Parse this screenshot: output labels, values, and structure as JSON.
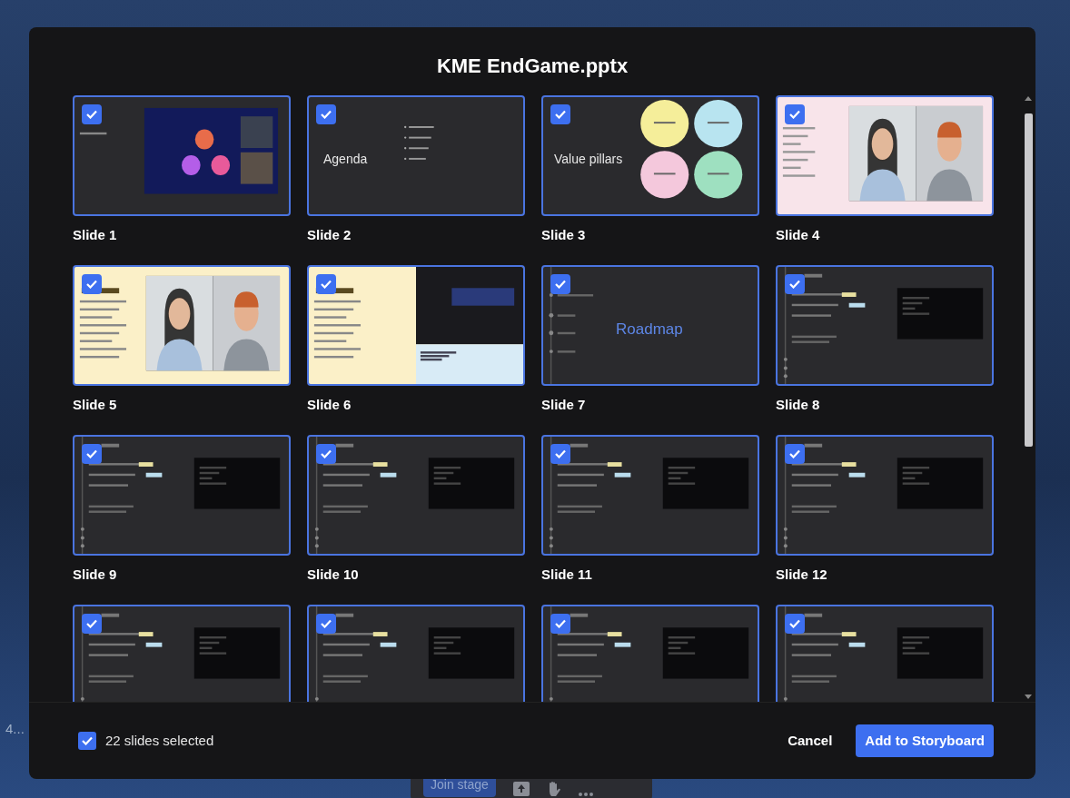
{
  "background": {
    "side_text": "4...",
    "stage_button": "Join stage"
  },
  "dialog": {
    "title": "KME EndGame.pptx"
  },
  "slides": [
    {
      "label": "Slide 1",
      "kind": "intro",
      "selected": true
    },
    {
      "label": "Slide 2",
      "kind": "agenda",
      "heading": "Agenda",
      "selected": true
    },
    {
      "label": "Slide 3",
      "kind": "pillars",
      "heading": "Value pillars",
      "selected": true
    },
    {
      "label": "Slide 4",
      "kind": "photo-pink",
      "selected": true
    },
    {
      "label": "Slide 5",
      "kind": "photo-yellow",
      "selected": true
    },
    {
      "label": "Slide 6",
      "kind": "screen-yellow",
      "selected": true
    },
    {
      "label": "Slide 7",
      "kind": "roadmap",
      "heading": "Roadmap",
      "selected": true
    },
    {
      "label": "Slide 8",
      "kind": "timeline",
      "selected": true
    },
    {
      "label": "Slide 9",
      "kind": "timeline",
      "selected": true
    },
    {
      "label": "Slide 10",
      "kind": "timeline",
      "selected": true
    },
    {
      "label": "Slide 11",
      "kind": "timeline",
      "selected": true
    },
    {
      "label": "Slide 12",
      "kind": "timeline",
      "selected": true
    },
    {
      "kind": "timeline",
      "selected": true
    },
    {
      "kind": "timeline",
      "selected": true
    },
    {
      "kind": "timeline",
      "selected": true
    },
    {
      "kind": "timeline",
      "selected": true
    }
  ],
  "footer": {
    "select_all": {
      "checked": true,
      "label": "22 slides selected"
    },
    "cancel": "Cancel",
    "confirm": "Add to Storyboard"
  }
}
